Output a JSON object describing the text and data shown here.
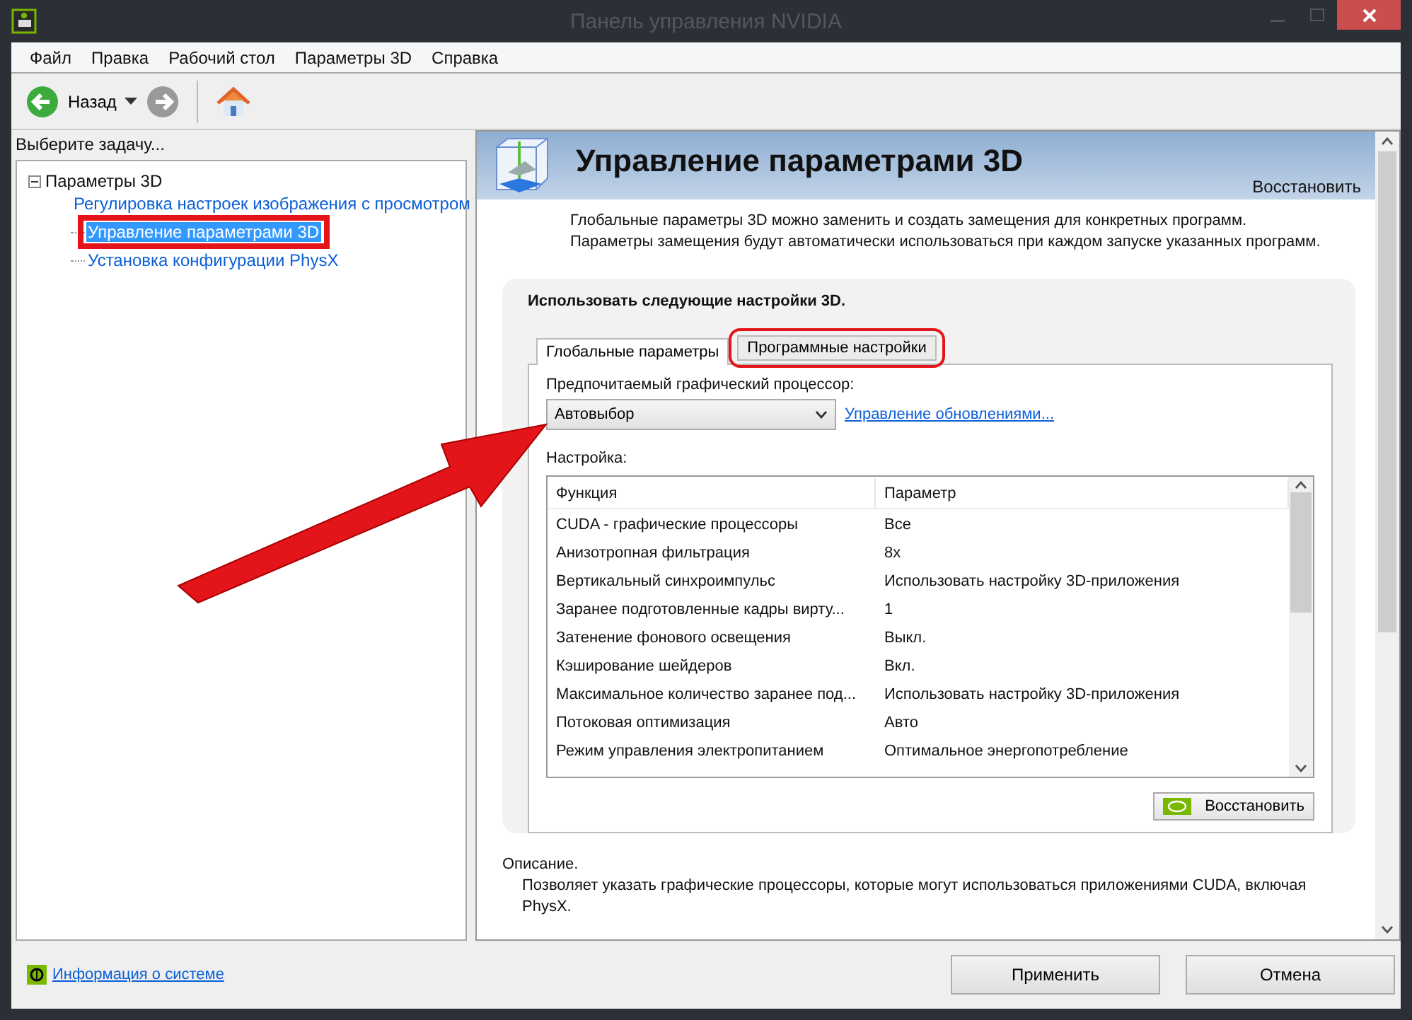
{
  "window": {
    "title": "Панель управления NVIDIA"
  },
  "menu": [
    "Файл",
    "Правка",
    "Рабочий стол",
    "Параметры 3D",
    "Справка"
  ],
  "toolbar": {
    "back_label": "Назад"
  },
  "task_panel": {
    "heading": "Выберите задачу...",
    "tree": [
      {
        "label": "Параметры 3D",
        "expanded": true,
        "children": [
          {
            "label": "Регулировка настроек изображения с просмотром",
            "selected": false,
            "highlighted": false
          },
          {
            "label": "Управление параметрами 3D",
            "selected": true,
            "highlighted": true
          },
          {
            "label": "Установка конфигурации PhysX",
            "selected": false,
            "highlighted": false
          }
        ]
      }
    ],
    "system_info_link": "Информация о системе"
  },
  "page": {
    "title": "Управление параметрами 3D",
    "restore_link": "Восстановить",
    "intro": "Глобальные параметры 3D можно заменить и создать замещения для конкретных программ. Параметры замещения будут автоматически использоваться при каждом запуске указанных программ.",
    "section_heading": "Использовать следующие настройки 3D.",
    "tabs": [
      {
        "label": "Глобальные параметры",
        "selected": true,
        "highlighted": false
      },
      {
        "label": "Программные настройки",
        "selected": false,
        "highlighted": true
      }
    ],
    "gpu_label": "Предпочитаемый графический процессор:",
    "gpu_value": "Автовыбор",
    "updates_link": "Управление обновлениями...",
    "settings_label": "Настройка:",
    "table": {
      "columns": [
        "Функция",
        "Параметр"
      ],
      "rows": [
        [
          "CUDA - графические процессоры",
          "Все"
        ],
        [
          "Анизотропная фильтрация",
          "8x"
        ],
        [
          "Вертикальный синхроимпульс",
          "Использовать настройку 3D-приложения"
        ],
        [
          "Заранее подготовленные кадры вирту...",
          "1"
        ],
        [
          "Затенение фонового освещения",
          "Выкл."
        ],
        [
          "Кэширование шейдеров",
          "Вкл."
        ],
        [
          "Максимальное количество заранее под...",
          "Использовать настройку 3D-приложения"
        ],
        [
          "Потоковая оптимизация",
          "Авто"
        ],
        [
          "Режим управления электропитанием",
          "Оптимальное энергопотребление"
        ]
      ]
    },
    "restore_button": "Восстановить",
    "description_heading": "Описание.",
    "description": "Позволяет указать графические процессоры, которые могут использоваться приложениями CUDA, включая PhysX."
  },
  "buttons": [
    "Применить",
    "Отмена"
  ]
}
